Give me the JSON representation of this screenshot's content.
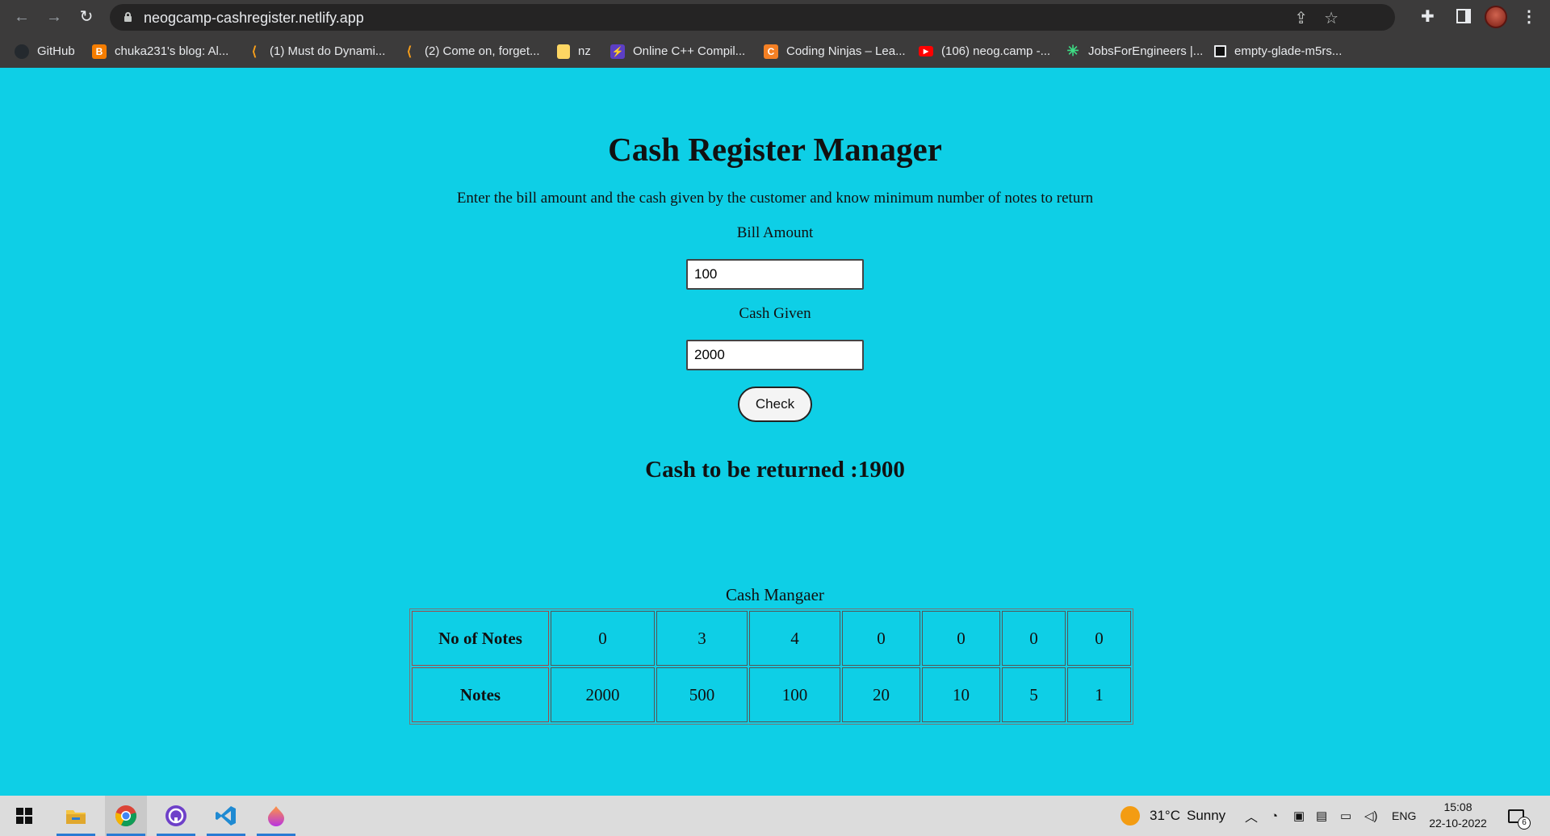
{
  "browser": {
    "url": "neogcamp-cashregister.netlify.app",
    "icons": [
      "back-arrow-icon",
      "forward-arrow-icon",
      "reload-icon",
      "lock-icon",
      "share-icon",
      "star-icon",
      "puzzle-icon",
      "side-panel-icon",
      "kebab-menu-icon"
    ],
    "bookmarks": [
      {
        "label": "GitHub",
        "icon": "github-icon",
        "color": "#24292e"
      },
      {
        "label": "chuka231's blog: Al...",
        "icon": "blogger-icon",
        "color": "#f57d00"
      },
      {
        "label": "(1) Must do Dynami...",
        "icon": "leetcode-icon",
        "color": "#f89f1b"
      },
      {
        "label": "(2) Come on, forget...",
        "icon": "leetcode-icon",
        "color": "#f89f1b"
      },
      {
        "label": "nz",
        "icon": "folder-icon",
        "color": "#fdd663"
      },
      {
        "label": "Online C++ Compil...",
        "icon": "bolt-icon",
        "color": "#5c3fc4"
      },
      {
        "label": "Coding Ninjas – Lea...",
        "icon": "coding-ninjas-icon",
        "color": "#f48024"
      },
      {
        "label": "(106) neog.camp -...",
        "icon": "youtube-icon",
        "color": "#ff0000"
      },
      {
        "label": "JobsForEngineers |...",
        "icon": "leaf-icon",
        "color": "#3ddc84"
      },
      {
        "label": "empty-glade-m5rs...",
        "icon": "page-icon",
        "color": "#111111"
      }
    ]
  },
  "page": {
    "title": "Cash Register Manager",
    "description": "Enter the bill amount and the cash given by the customer and know minimum number of notes to return",
    "bill_label": "Bill Amount",
    "bill_value": "100",
    "cash_label": "Cash Given",
    "cash_value": "2000",
    "check_label": "Check",
    "result_prefix": "Cash to be returned :",
    "result_value": "1900",
    "table_caption": "Cash Mangaer",
    "row_notes_count_header": "No of Notes",
    "row_notes_header": "Notes",
    "notes_count": [
      "0",
      "3",
      "4",
      "0",
      "0",
      "0",
      "0"
    ],
    "notes": [
      "2000",
      "500",
      "100",
      "20",
      "10",
      "5",
      "1"
    ]
  },
  "taskbar": {
    "apps": [
      "windows-start-icon",
      "file-explorer-icon",
      "chrome-icon",
      "github-desktop-icon",
      "vscode-icon",
      "firefox-icon"
    ],
    "weather_temp": "31°C",
    "weather_text": "Sunny",
    "language": "ENG",
    "time": "15:08",
    "date": "22-10-2022",
    "notification_count": "6"
  },
  "colors": {
    "page_background": "#0ecfe6",
    "browser_chrome": "#3c3b3b",
    "omnibox": "#252424",
    "taskbar": "#dcdcdc"
  }
}
